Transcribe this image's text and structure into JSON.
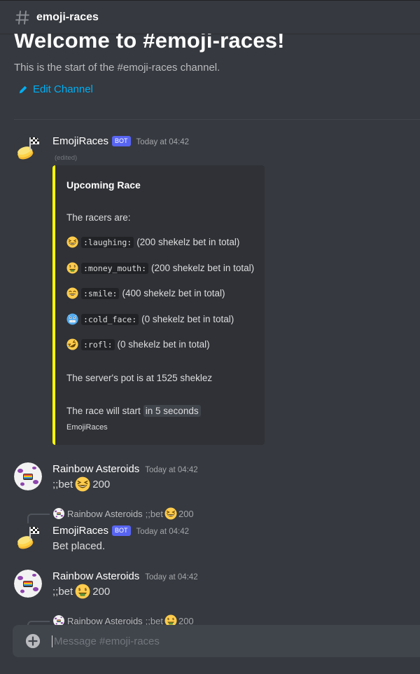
{
  "header": {
    "channel_name": "emoji-races",
    "icon": "hash-icon"
  },
  "welcome": {
    "title": "Welcome to #emoji-races!",
    "subtitle": "This is the start of the #emoji-races channel.",
    "edit_label": "Edit Channel"
  },
  "colors": {
    "accent": "#00aff4",
    "embed_border": "#ffff00",
    "bot_tag": "#5865f2",
    "background": "#36393f"
  },
  "messages": [
    {
      "username": "EmojiRaces",
      "bot_tag": "BOT",
      "timestamp": "Today at 04:42",
      "edited": "(edited)",
      "embed": {
        "title": "Upcoming Race",
        "intro": "The racers are:",
        "racers": [
          {
            "emoji": "laughing",
            "code": ":laughing:",
            "text": "(200 shekelz bet in total)"
          },
          {
            "emoji": "money_mouth",
            "code": ":money_mouth:",
            "text": "(200 shekelz bet in total)"
          },
          {
            "emoji": "smile",
            "code": ":smile:",
            "text": "(400 shekelz bet in total)"
          },
          {
            "emoji": "cold_face",
            "code": ":cold_face:",
            "text": "(0 shekelz bet in total)"
          },
          {
            "emoji": "rofl",
            "code": ":rofl:",
            "text": "(0 shekelz bet in total)"
          }
        ],
        "pot": "The server's pot is at 1525 sheklez",
        "start_prefix": "The race will start",
        "start_highlight": "in 5 seconds",
        "footer": "EmojiRaces"
      }
    },
    {
      "username": "Rainbow Asteroids",
      "timestamp": "Today at 04:42",
      "text_prefix": ";;bet",
      "emoji": "laughing",
      "text_suffix": "200"
    },
    {
      "reply": {
        "username": "Rainbow Asteroids",
        "text_prefix": ";;bet",
        "emoji": "laughing",
        "text_suffix": "200"
      },
      "username": "EmojiRaces",
      "bot_tag": "BOT",
      "timestamp": "Today at 04:42",
      "text": "Bet placed."
    },
    {
      "username": "Rainbow Asteroids",
      "timestamp": "Today at 04:42",
      "text_prefix": ";;bet",
      "emoji": "money_mouth",
      "text_suffix": "200"
    },
    {
      "reply": {
        "username": "Rainbow Asteroids",
        "text_prefix": ";;bet",
        "emoji": "money_mouth",
        "text_suffix": "200"
      }
    }
  ],
  "composer": {
    "placeholder": "Message #emoji-races",
    "add_icon": "plus-circle-icon"
  }
}
